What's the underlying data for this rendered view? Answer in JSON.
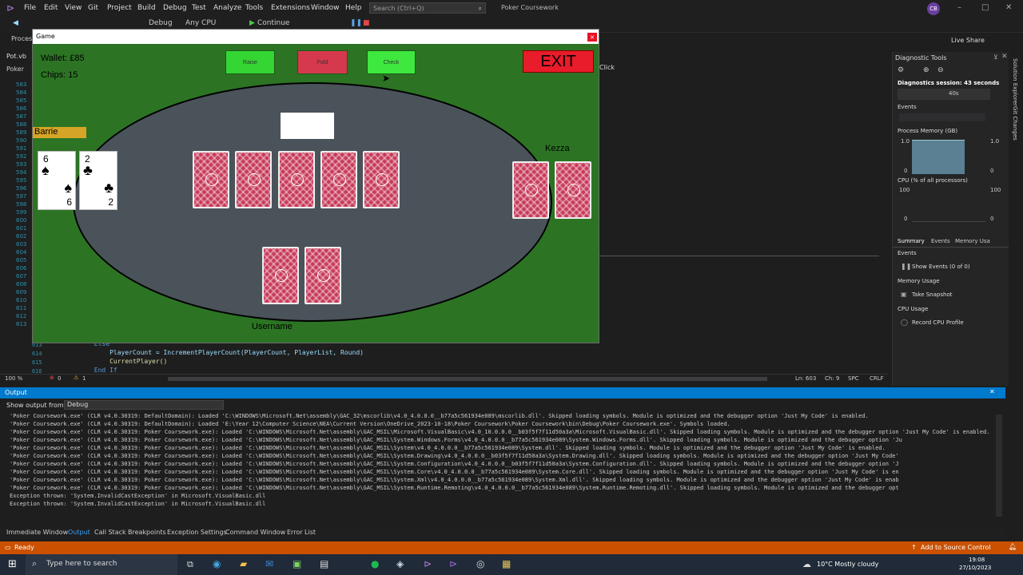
{
  "menu": {
    "items": [
      "File",
      "Edit",
      "View",
      "Git",
      "Project",
      "Build",
      "Debug",
      "Test",
      "Analyze",
      "Tools",
      "Extensions",
      "Window",
      "Help"
    ],
    "search_placeholder": "Search (Ctrl+Q)",
    "solution_name": "Poker Coursework",
    "avatar_initials": "CB"
  },
  "toolbar": {
    "debug_config": "Debug",
    "platform": "Any CPU",
    "continue_label": "Continue",
    "live_share": "Live Share",
    "process_label": "Process"
  },
  "editor": {
    "doc_tab": "Pot.vb",
    "doc_tab_2": "Poker",
    "line_numbers_top": [
      "583",
      "584",
      "585",
      "586",
      "587",
      "588",
      "589",
      "590",
      "591",
      "592",
      "593",
      "594",
      "595",
      "596",
      "597",
      "598",
      "599",
      "600",
      "601",
      "602",
      "603",
      "604",
      "605",
      "606",
      "607",
      "608",
      "609",
      "610",
      "611",
      "612",
      "613"
    ],
    "code_lines": [
      {
        "num": "613",
        "text": "            Else"
      },
      {
        "num": "614",
        "text": "                PlayerCount = IncrementPlayerCount(PlayerCount, PlayerList, Round)"
      },
      {
        "num": "615",
        "text": "                CurrentPlayer()"
      },
      {
        "num": "616",
        "text": "            End If"
      }
    ],
    "click_label": "Click",
    "zoom": "100 %",
    "errors": "0",
    "warnings": "1",
    "position": "Ln: 603",
    "char": "Ch: 9",
    "spc": "SPC",
    "crlf": "CRLF"
  },
  "game": {
    "window_title": "Game",
    "close_glyph": "×",
    "wallet": "Wallet: £85",
    "chips": "Chips: 15",
    "raise_label": "Raise",
    "fold_label": "Fold",
    "check_label": "Check",
    "exit_label": "EXIT",
    "player_left_name": "Barrie",
    "player_right_name": "Kezza",
    "player_bottom_name": "Username",
    "left_cards": [
      {
        "rank": "6",
        "suit": "♠"
      },
      {
        "rank": "2",
        "suit": "♣"
      }
    ],
    "colors": {
      "felt": "#2c7424",
      "table": "#4a525a",
      "raise": "#33d633",
      "fold": "#d6384e",
      "check": "#3ee83e",
      "exit": "#e81c2a",
      "name_tag": "#d6a427"
    }
  },
  "diagnostics": {
    "title": "Diagnostic Tools",
    "session": "Diagnostics session: 43 seconds",
    "timeline_label": "40s",
    "events_header": "Events",
    "memory_header": "Process Memory (GB)",
    "memory_max": "1.0",
    "memory_min": "0",
    "cpu_header": "CPU (% of all processors)",
    "cpu_max": "100",
    "cpu_min": "0",
    "tabs": [
      "Summary",
      "Events",
      "Memory Usa"
    ],
    "events_section": "Events",
    "show_events": "Show Events (0 of 0)",
    "memory_usage": "Memory Usage",
    "take_snapshot": "Take Snapshot",
    "cpu_usage": "CPU Usage",
    "record_cpu": "Record CPU Profile",
    "side_tabs": [
      "Solution Explorer",
      "Git Changes"
    ]
  },
  "output": {
    "title": "Output",
    "show_from_label": "Show output from:",
    "source": "Debug",
    "lines": [
      "'Poker Coursework.exe' (CLR v4.0.30319: DefaultDomain): Loaded 'C:\\WINDOWS\\Microsoft.Net\\assembly\\GAC_32\\mscorlib\\v4.0_4.0.0.0__b77a5c561934e089\\mscorlib.dll'. Skipped loading symbols. Module is optimized and the debugger option 'Just My Code' is enabled.",
      "'Poker Coursework.exe' (CLR v4.0.30319: DefaultDomain): Loaded 'E:\\Year 12\\Computer Science\\NEA\\Current Version\\OneDrive_2023-10-18\\Poker Coursework\\Poker Coursework\\bin\\Debug\\Poker Coursework.exe'. Symbols loaded.",
      "'Poker Coursework.exe' (CLR v4.0.30319: Poker Coursework.exe): Loaded 'C:\\WINDOWS\\Microsoft.Net\\assembly\\GAC_MSIL\\Microsoft.VisualBasic\\v4.0_10.0.0.0__b03f5f7f11d50a3a\\Microsoft.VisualBasic.dll'. Skipped loading symbols. Module is optimized and the debugger option 'Just My Code' is enabled.",
      "'Poker Coursework.exe' (CLR v4.0.30319: Poker Coursework.exe): Loaded 'C:\\WINDOWS\\Microsoft.Net\\assembly\\GAC_MSIL\\System.Windows.Forms\\v4.0_4.0.0.0__b77a5c561934e089\\System.Windows.Forms.dll'. Skipped loading symbols. Module is optimized and the debugger option 'Ju",
      "'Poker Coursework.exe' (CLR v4.0.30319: Poker Coursework.exe): Loaded 'C:\\WINDOWS\\Microsoft.Net\\assembly\\GAC_MSIL\\System\\v4.0_4.0.0.0__b77a5c561934e089\\System.dll'. Skipped loading symbols. Module is optimized and the debugger option 'Just My Code' is enabled.",
      "'Poker Coursework.exe' (CLR v4.0.30319: Poker Coursework.exe): Loaded 'C:\\WINDOWS\\Microsoft.Net\\assembly\\GAC_MSIL\\System.Drawing\\v4.0_4.0.0.0__b03f5f7f11d50a3a\\System.Drawing.dll'. Skipped loading symbols. Module is optimized and the debugger option 'Just My Code'",
      "'Poker Coursework.exe' (CLR v4.0.30319: Poker Coursework.exe): Loaded 'C:\\WINDOWS\\Microsoft.Net\\assembly\\GAC_MSIL\\System.Configuration\\v4.0_4.0.0.0__b03f5f7f11d50a3a\\System.Configuration.dll'. Skipped loading symbols. Module is optimized and the debugger option 'J",
      "'Poker Coursework.exe' (CLR v4.0.30319: Poker Coursework.exe): Loaded 'C:\\WINDOWS\\Microsoft.Net\\assembly\\GAC_MSIL\\System.Core\\v4.0_4.0.0.0__b77a5c561934e089\\System.Core.dll'. Skipped loading symbols. Module is optimized and the debugger option 'Just My Code' is en",
      "'Poker Coursework.exe' (CLR v4.0.30319: Poker Coursework.exe): Loaded 'C:\\WINDOWS\\Microsoft.Net\\assembly\\GAC_MSIL\\System.Xml\\v4.0_4.0.0.0__b77a5c561934e089\\System.Xml.dll'. Skipped loading symbols. Module is optimized and the debugger option 'Just My Code' is enab",
      "'Poker Coursework.exe' (CLR v4.0.30319: Poker Coursework.exe): Loaded 'C:\\WINDOWS\\Microsoft.Net\\assembly\\GAC_MSIL\\System.Runtime.Remoting\\v4.0_4.0.0.0__b77a5c561934e089\\System.Runtime.Remoting.dll'. Skipped loading symbols. Module is optimized and the debugger opt",
      "Exception thrown: 'System.InvalidCastException' in Microsoft.VisualBasic.dll",
      "Exception thrown: 'System.InvalidCastException' in Microsoft.VisualBasic.dll"
    ]
  },
  "bottom_tabs": [
    "Immediate Window",
    "Output",
    "Call Stack",
    "Breakpoints",
    "Exception Settings",
    "Command Window",
    "Error List"
  ],
  "status": {
    "ready": "Ready",
    "source_control": "Add to Source Control"
  },
  "taskbar": {
    "search_placeholder": "Type here to search",
    "weather": "10°C  Mostly cloudy",
    "time": "19:08",
    "date": "27/10/2023"
  }
}
